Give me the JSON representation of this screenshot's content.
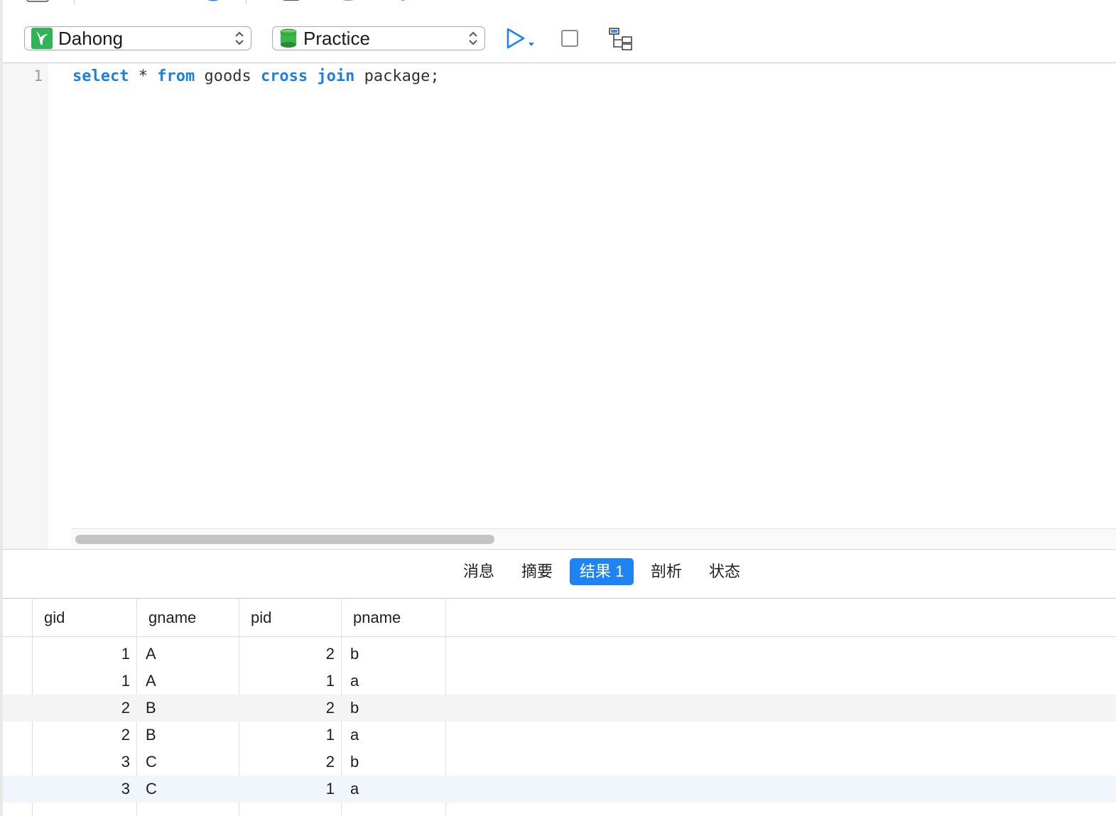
{
  "toolbar": {
    "connection": {
      "label": "Dahong"
    },
    "database": {
      "label": "Practice"
    }
  },
  "editor": {
    "line_number": "1",
    "tokens": {
      "t1": "select",
      "t2": " * ",
      "t3": "from",
      "t4": " goods ",
      "t5": "cross",
      "t6": " ",
      "t7": "join",
      "t8": " package;"
    }
  },
  "tabs": [
    {
      "label": "消息"
    },
    {
      "label": "摘要"
    },
    {
      "label": "结果 1"
    },
    {
      "label": "剖析"
    },
    {
      "label": "状态"
    }
  ],
  "grid": {
    "columns": [
      "gid",
      "gname",
      "pid",
      "pname"
    ],
    "rows": [
      [
        "1",
        "A",
        "2",
        "b"
      ],
      [
        "1",
        "A",
        "1",
        "a"
      ],
      [
        "2",
        "B",
        "2",
        "b"
      ],
      [
        "2",
        "B",
        "1",
        "a"
      ],
      [
        "3",
        "C",
        "2",
        "b"
      ],
      [
        "3",
        "C",
        "1",
        "a"
      ]
    ]
  },
  "colors": {
    "keyword": "#1f7fe0",
    "active_tab": "#1f83f0",
    "connection_icon": "#2fb45a",
    "database_icon": "#3cb44a"
  }
}
